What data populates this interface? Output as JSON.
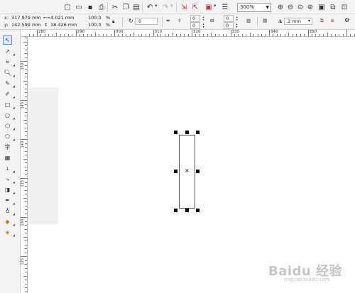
{
  "toolbar": {
    "zoom_value": "300%"
  },
  "propbar": {
    "x_label": "x:",
    "x_value": "317.979 mm",
    "y_label": "y:",
    "y_value": "142.599 mm",
    "width_value": "4.021 mm",
    "height_value": "18.426 mm",
    "scale_x": "100.0",
    "scale_y": "100.0",
    "pct1": "%",
    "pct2": "%",
    "rotation": ".0",
    "corner_a": "0",
    "corner_b": "0",
    "corner_c": "0",
    "corner_d": "0",
    "outline_width": ".2 mm"
  },
  "ruler": {
    "h_labels": [
      "280",
      "290",
      "300",
      "310",
      "320",
      "330",
      "340",
      "350"
    ],
    "v_labels": [
      "150",
      "145",
      "140",
      "135",
      "130",
      "125"
    ]
  },
  "watermark": {
    "brand": "Baidu 经验",
    "url": "jingyan.baidu.com"
  }
}
